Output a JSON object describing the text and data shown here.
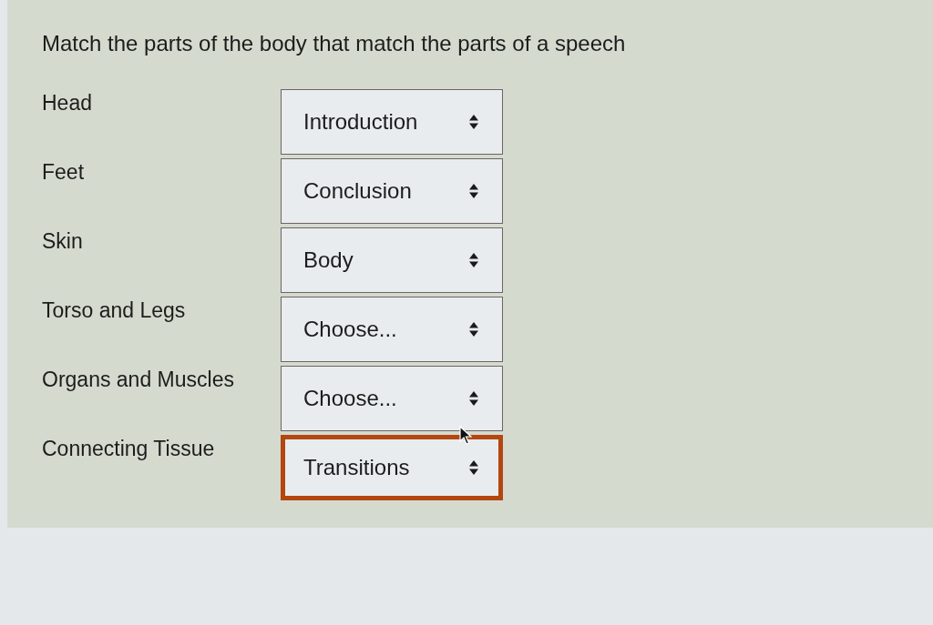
{
  "question": {
    "prompt": "Match the parts of the body that match the parts of a speech"
  },
  "rows": [
    {
      "label": "Head",
      "value": "Introduction",
      "focused": false
    },
    {
      "label": "Feet",
      "value": "Conclusion",
      "focused": false
    },
    {
      "label": "Skin",
      "value": "Body",
      "focused": false
    },
    {
      "label": "Torso and Legs",
      "value": "Choose...",
      "focused": false
    },
    {
      "label": "Organs and Muscles",
      "value": "Choose...",
      "focused": false
    },
    {
      "label": "Connecting Tissue",
      "value": "Transitions",
      "focused": true
    }
  ]
}
